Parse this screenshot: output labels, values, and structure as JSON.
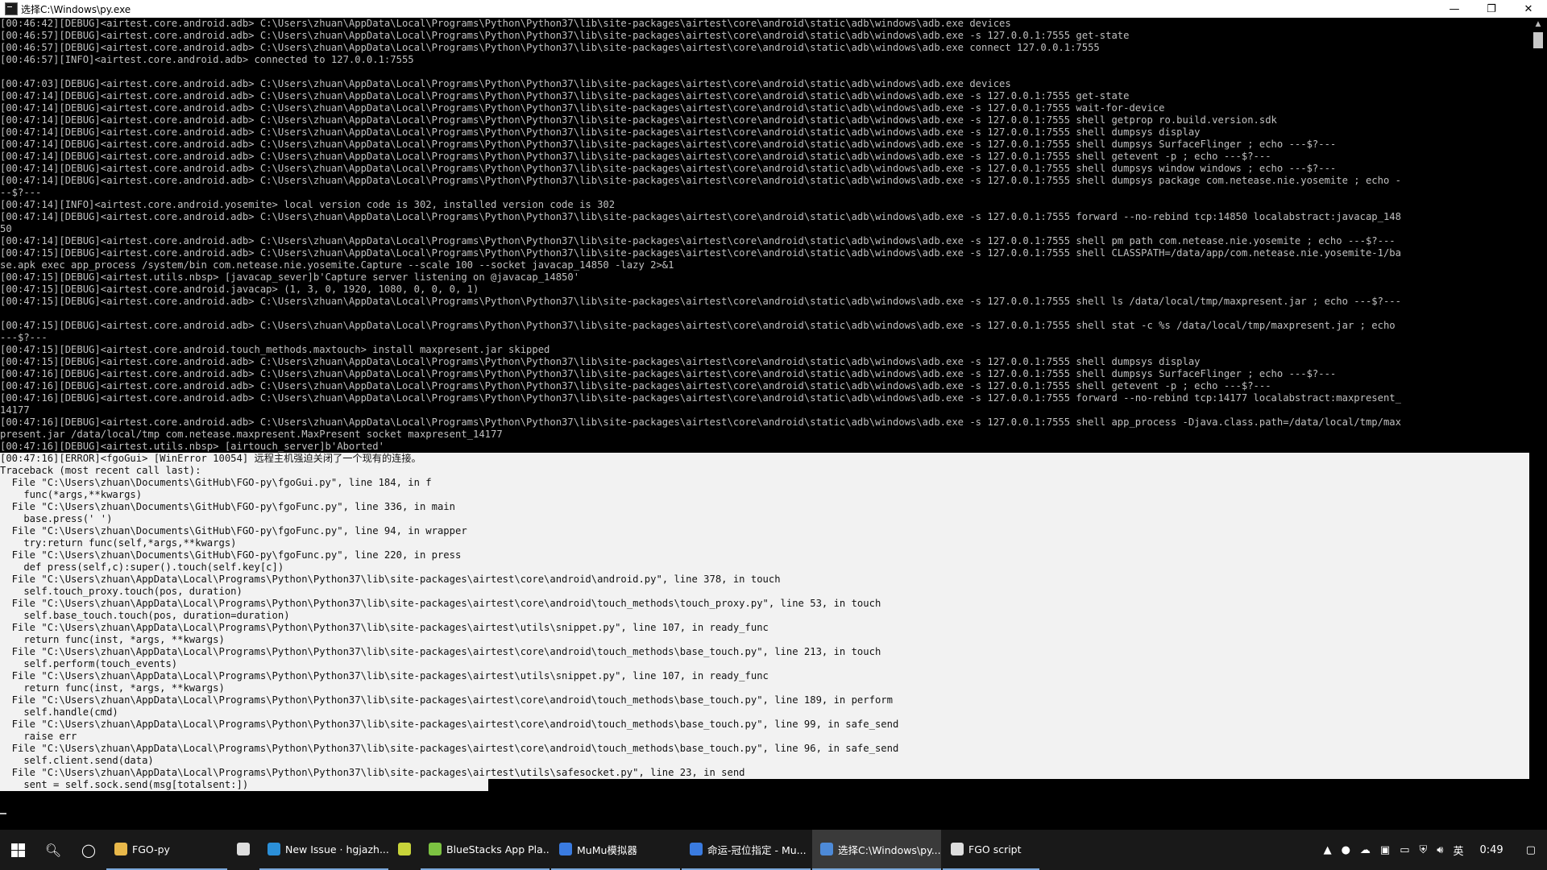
{
  "window": {
    "title": "选择C:\\Windows\\py.exe",
    "min": "—",
    "restore": "❐",
    "close": "✕"
  },
  "console": {
    "lines": [
      "[00:46:42][DEBUG]<airtest.core.android.adb> C:\\Users\\zhuan\\AppData\\Local\\Programs\\Python\\Python37\\lib\\site-packages\\airtest\\core\\android\\static\\adb\\windows\\adb.exe devices",
      "[00:46:57][DEBUG]<airtest.core.android.adb> C:\\Users\\zhuan\\AppData\\Local\\Programs\\Python\\Python37\\lib\\site-packages\\airtest\\core\\android\\static\\adb\\windows\\adb.exe -s 127.0.0.1:7555 get-state",
      "[00:46:57][DEBUG]<airtest.core.android.adb> C:\\Users\\zhuan\\AppData\\Local\\Programs\\Python\\Python37\\lib\\site-packages\\airtest\\core\\android\\static\\adb\\windows\\adb.exe connect 127.0.0.1:7555",
      "[00:46:57][INFO]<airtest.core.android.adb> connected to 127.0.0.1:7555",
      "",
      "[00:47:03][DEBUG]<airtest.core.android.adb> C:\\Users\\zhuan\\AppData\\Local\\Programs\\Python\\Python37\\lib\\site-packages\\airtest\\core\\android\\static\\adb\\windows\\adb.exe devices",
      "[00:47:14][DEBUG]<airtest.core.android.adb> C:\\Users\\zhuan\\AppData\\Local\\Programs\\Python\\Python37\\lib\\site-packages\\airtest\\core\\android\\static\\adb\\windows\\adb.exe -s 127.0.0.1:7555 get-state",
      "[00:47:14][DEBUG]<airtest.core.android.adb> C:\\Users\\zhuan\\AppData\\Local\\Programs\\Python\\Python37\\lib\\site-packages\\airtest\\core\\android\\static\\adb\\windows\\adb.exe -s 127.0.0.1:7555 wait-for-device",
      "[00:47:14][DEBUG]<airtest.core.android.adb> C:\\Users\\zhuan\\AppData\\Local\\Programs\\Python\\Python37\\lib\\site-packages\\airtest\\core\\android\\static\\adb\\windows\\adb.exe -s 127.0.0.1:7555 shell getprop ro.build.version.sdk",
      "[00:47:14][DEBUG]<airtest.core.android.adb> C:\\Users\\zhuan\\AppData\\Local\\Programs\\Python\\Python37\\lib\\site-packages\\airtest\\core\\android\\static\\adb\\windows\\adb.exe -s 127.0.0.1:7555 shell dumpsys display",
      "[00:47:14][DEBUG]<airtest.core.android.adb> C:\\Users\\zhuan\\AppData\\Local\\Programs\\Python\\Python37\\lib\\site-packages\\airtest\\core\\android\\static\\adb\\windows\\adb.exe -s 127.0.0.1:7555 shell dumpsys SurfaceFlinger ; echo ---$?---",
      "[00:47:14][DEBUG]<airtest.core.android.adb> C:\\Users\\zhuan\\AppData\\Local\\Programs\\Python\\Python37\\lib\\site-packages\\airtest\\core\\android\\static\\adb\\windows\\adb.exe -s 127.0.0.1:7555 shell getevent -p ; echo ---$?---",
      "[00:47:14][DEBUG]<airtest.core.android.adb> C:\\Users\\zhuan\\AppData\\Local\\Programs\\Python\\Python37\\lib\\site-packages\\airtest\\core\\android\\static\\adb\\windows\\adb.exe -s 127.0.0.1:7555 shell dumpsys window windows ; echo ---$?---",
      "[00:47:14][DEBUG]<airtest.core.android.adb> C:\\Users\\zhuan\\AppData\\Local\\Programs\\Python\\Python37\\lib\\site-packages\\airtest\\core\\android\\static\\adb\\windows\\adb.exe -s 127.0.0.1:7555 shell dumpsys package com.netease.nie.yosemite ; echo -",
      "--$?---",
      "[00:47:14][INFO]<airtest.core.android.yosemite> local version code is 302, installed version code is 302",
      "[00:47:14][DEBUG]<airtest.core.android.adb> C:\\Users\\zhuan\\AppData\\Local\\Programs\\Python\\Python37\\lib\\site-packages\\airtest\\core\\android\\static\\adb\\windows\\adb.exe -s 127.0.0.1:7555 forward --no-rebind tcp:14850 localabstract:javacap_148",
      "50",
      "[00:47:14][DEBUG]<airtest.core.android.adb> C:\\Users\\zhuan\\AppData\\Local\\Programs\\Python\\Python37\\lib\\site-packages\\airtest\\core\\android\\static\\adb\\windows\\adb.exe -s 127.0.0.1:7555 shell pm path com.netease.nie.yosemite ; echo ---$?---",
      "[00:47:15][DEBUG]<airtest.core.android.adb> C:\\Users\\zhuan\\AppData\\Local\\Programs\\Python\\Python37\\lib\\site-packages\\airtest\\core\\android\\static\\adb\\windows\\adb.exe -s 127.0.0.1:7555 shell CLASSPATH=/data/app/com.netease.nie.yosemite-1/ba",
      "se.apk exec app_process /system/bin com.netease.nie.yosemite.Capture --scale 100 --socket javacap_14850 -lazy 2>&1",
      "[00:47:15][DEBUG]<airtest.utils.nbsp> [javacap_sever]b'Capture server listening on @javacap_14850'",
      "[00:47:15][DEBUG]<airtest.core.android.javacap> (1, 3, 0, 1920, 1080, 0, 0, 0, 1)",
      "[00:47:15][DEBUG]<airtest.core.android.adb> C:\\Users\\zhuan\\AppData\\Local\\Programs\\Python\\Python37\\lib\\site-packages\\airtest\\core\\android\\static\\adb\\windows\\adb.exe -s 127.0.0.1:7555 shell ls /data/local/tmp/maxpresent.jar ; echo ---$?---",
      "",
      "[00:47:15][DEBUG]<airtest.core.android.adb> C:\\Users\\zhuan\\AppData\\Local\\Programs\\Python\\Python37\\lib\\site-packages\\airtest\\core\\android\\static\\adb\\windows\\adb.exe -s 127.0.0.1:7555 shell stat -c %s /data/local/tmp/maxpresent.jar ; echo",
      "---$?---",
      "[00:47:15][DEBUG]<airtest.core.android.touch_methods.maxtouch> install maxpresent.jar skipped",
      "[00:47:15][DEBUG]<airtest.core.android.adb> C:\\Users\\zhuan\\AppData\\Local\\Programs\\Python\\Python37\\lib\\site-packages\\airtest\\core\\android\\static\\adb\\windows\\adb.exe -s 127.0.0.1:7555 shell dumpsys display",
      "[00:47:16][DEBUG]<airtest.core.android.adb> C:\\Users\\zhuan\\AppData\\Local\\Programs\\Python\\Python37\\lib\\site-packages\\airtest\\core\\android\\static\\adb\\windows\\adb.exe -s 127.0.0.1:7555 shell dumpsys SurfaceFlinger ; echo ---$?---",
      "[00:47:16][DEBUG]<airtest.core.android.adb> C:\\Users\\zhuan\\AppData\\Local\\Programs\\Python\\Python37\\lib\\site-packages\\airtest\\core\\android\\static\\adb\\windows\\adb.exe -s 127.0.0.1:7555 shell getevent -p ; echo ---$?---",
      "[00:47:16][DEBUG]<airtest.core.android.adb> C:\\Users\\zhuan\\AppData\\Local\\Programs\\Python\\Python37\\lib\\site-packages\\airtest\\core\\android\\static\\adb\\windows\\adb.exe -s 127.0.0.1:7555 forward --no-rebind tcp:14177 localabstract:maxpresent_",
      "14177",
      "[00:47:16][DEBUG]<airtest.core.android.adb> C:\\Users\\zhuan\\AppData\\Local\\Programs\\Python\\Python37\\lib\\site-packages\\airtest\\core\\android\\static\\adb\\windows\\adb.exe -s 127.0.0.1:7555 shell app_process -Djava.class.path=/data/local/tmp/max",
      "present.jar /data/local/tmp com.netease.maxpresent.MaxPresent socket maxpresent_14177",
      "[00:47:16][DEBUG]<airtest.utils.nbsp> [airtouch_server]b'Aborted'"
    ],
    "selected_lines": [
      "[00:47:16][ERROR]<fgoGui> [WinError 10054] 远程主机强迫关闭了一个现有的连接。",
      "Traceback (most recent call last):",
      "  File \"C:\\Users\\zhuan\\Documents\\GitHub\\FGO-py\\fgoGui.py\", line 184, in f",
      "    func(*args,**kwargs)",
      "  File \"C:\\Users\\zhuan\\Documents\\GitHub\\FGO-py\\fgoFunc.py\", line 336, in main",
      "    base.press(' ')",
      "  File \"C:\\Users\\zhuan\\Documents\\GitHub\\FGO-py\\fgoFunc.py\", line 94, in wrapper",
      "    try:return func(self,*args,**kwargs)",
      "  File \"C:\\Users\\zhuan\\Documents\\GitHub\\FGO-py\\fgoFunc.py\", line 220, in press",
      "    def press(self,c):super().touch(self.key[c])",
      "  File \"C:\\Users\\zhuan\\AppData\\Local\\Programs\\Python\\Python37\\lib\\site-packages\\airtest\\core\\android\\android.py\", line 378, in touch",
      "    self.touch_proxy.touch(pos, duration)",
      "  File \"C:\\Users\\zhuan\\AppData\\Local\\Programs\\Python\\Python37\\lib\\site-packages\\airtest\\core\\android\\touch_methods\\touch_proxy.py\", line 53, in touch",
      "    self.base_touch.touch(pos, duration=duration)",
      "  File \"C:\\Users\\zhuan\\AppData\\Local\\Programs\\Python\\Python37\\lib\\site-packages\\airtest\\utils\\snippet.py\", line 107, in ready_func",
      "    return func(inst, *args, **kwargs)",
      "  File \"C:\\Users\\zhuan\\AppData\\Local\\Programs\\Python\\Python37\\lib\\site-packages\\airtest\\core\\android\\touch_methods\\base_touch.py\", line 213, in touch",
      "    self.perform(touch_events)",
      "  File \"C:\\Users\\zhuan\\AppData\\Local\\Programs\\Python\\Python37\\lib\\site-packages\\airtest\\utils\\snippet.py\", line 107, in ready_func",
      "    return func(inst, *args, **kwargs)",
      "  File \"C:\\Users\\zhuan\\AppData\\Local\\Programs\\Python\\Python37\\lib\\site-packages\\airtest\\core\\android\\touch_methods\\base_touch.py\", line 189, in perform",
      "    self.handle(cmd)",
      "  File \"C:\\Users\\zhuan\\AppData\\Local\\Programs\\Python\\Python37\\lib\\site-packages\\airtest\\core\\android\\touch_methods\\base_touch.py\", line 99, in safe_send",
      "    raise err",
      "  File \"C:\\Users\\zhuan\\AppData\\Local\\Programs\\Python\\Python37\\lib\\site-packages\\airtest\\core\\android\\touch_methods\\base_touch.py\", line 96, in safe_send",
      "    self.client.send(data)",
      "  File \"C:\\Users\\zhuan\\AppData\\Local\\Programs\\Python\\Python37\\lib\\site-packages\\airtest\\utils\\safesocket.py\", line 23, in send",
      "    sent = self.sock.send(msg[totalsent:])"
    ]
  },
  "taskbar": {
    "items": [
      {
        "label": "FGO-py",
        "icon": "folder-icon",
        "color": "#e8b84a",
        "active": false
      },
      {
        "label": "",
        "icon": "store-icon",
        "color": "#dddddd",
        "active": false,
        "plain": true
      },
      {
        "label": "New Issue · hgjazh...",
        "icon": "edge-icon",
        "color": "#2b8fd8",
        "active": false
      },
      {
        "label": "",
        "icon": "app-yellow-icon",
        "color": "#c8d43a",
        "active": false,
        "plain": true
      },
      {
        "label": "BlueStacks App Pla...",
        "icon": "bluestacks-icon",
        "color": "#7cc242",
        "active": false
      },
      {
        "label": "MuMu模拟器",
        "icon": "mumu-icon",
        "color": "#3a7be0",
        "active": false
      },
      {
        "label": "命运-冠位指定 - Mu...",
        "icon": "mumu-game-icon",
        "color": "#3a7be0",
        "active": false
      },
      {
        "label": "选择C:\\Windows\\py....",
        "icon": "python-icon",
        "color": "#4d8ad8",
        "active": true
      },
      {
        "label": "FGO script",
        "icon": "script-window-icon",
        "color": "#dddddd",
        "active": false
      }
    ],
    "ime": "英",
    "clock": "0:49"
  }
}
